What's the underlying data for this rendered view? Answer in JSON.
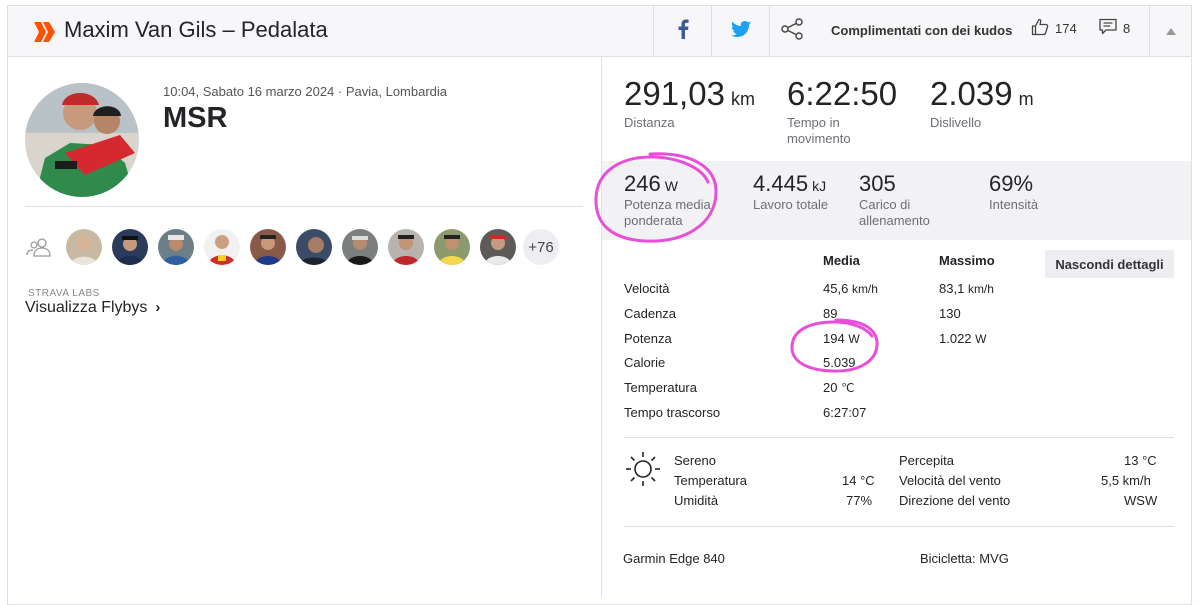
{
  "header": {
    "title": "Maxim Van Gils – Pedalata",
    "kudos_text": "Complimentati con dei kudos",
    "kudos_count": "174",
    "comments_count": "8"
  },
  "activity": {
    "meta": "10:04, Sabato 16 marzo 2024 · Pavia, Lombardia",
    "name": "MSR"
  },
  "group": {
    "more": "+76"
  },
  "flybys": {
    "labs": "STRAVA LABS",
    "label": "Visualizza Flybys"
  },
  "primary_stats": [
    {
      "value": "291,03",
      "unit": "km",
      "label": "Distanza"
    },
    {
      "value": "6:22:50",
      "unit": "",
      "label": "Tempo in movimento"
    },
    {
      "value": "2.039",
      "unit": "m",
      "label": "Dislivello"
    }
  ],
  "secondary_stats": [
    {
      "value": "246",
      "unit": "W",
      "label": "Potenza media ponderata"
    },
    {
      "value": "4.445",
      "unit": "kJ",
      "label": "Lavoro totale"
    },
    {
      "value": "305",
      "unit": "",
      "label": "Carico di allenamento"
    },
    {
      "value": "69%",
      "unit": "",
      "label": "Intensità"
    }
  ],
  "details": {
    "col_avg": "Media",
    "col_max": "Massimo",
    "hide_button": "Nascondi dettagli",
    "rows": [
      {
        "label": "Velocità",
        "avg": "45,6",
        "avg_unit": "km/h",
        "max": "83,1",
        "max_unit": "km/h"
      },
      {
        "label": "Cadenza",
        "avg": "89",
        "avg_unit": "",
        "max": "130",
        "max_unit": ""
      },
      {
        "label": "Potenza",
        "avg": "194",
        "avg_unit": "W",
        "max": "1.022",
        "max_unit": "W"
      },
      {
        "label": "Calorie",
        "avg": "5.039",
        "avg_unit": "",
        "max": "",
        "max_unit": ""
      },
      {
        "label": "Temperatura",
        "avg": "20",
        "avg_unit": "℃",
        "max": "",
        "max_unit": ""
      },
      {
        "label": "Tempo trascorso",
        "avg": "6:27:07",
        "avg_unit": "",
        "max": "",
        "max_unit": ""
      }
    ]
  },
  "weather": {
    "condition": "Sereno",
    "temp_label": "Temperatura",
    "temp": "14 °C",
    "humidity_label": "Umidità",
    "humidity": "77%",
    "feels_label": "Percepita",
    "feels": "13 °C",
    "wind_speed_label": "Velocità del vento",
    "wind_speed": "5,5 km/h",
    "wind_dir_label": "Direzione del vento",
    "wind_dir": "WSW"
  },
  "equipment": {
    "device": "Garmin Edge 840",
    "bike": "Bicicletta: MVG"
  },
  "colors": {
    "brand": "#fc5200",
    "facebook": "#3b5998",
    "twitter": "#1da1f2",
    "annotation": "#e84fd9"
  }
}
